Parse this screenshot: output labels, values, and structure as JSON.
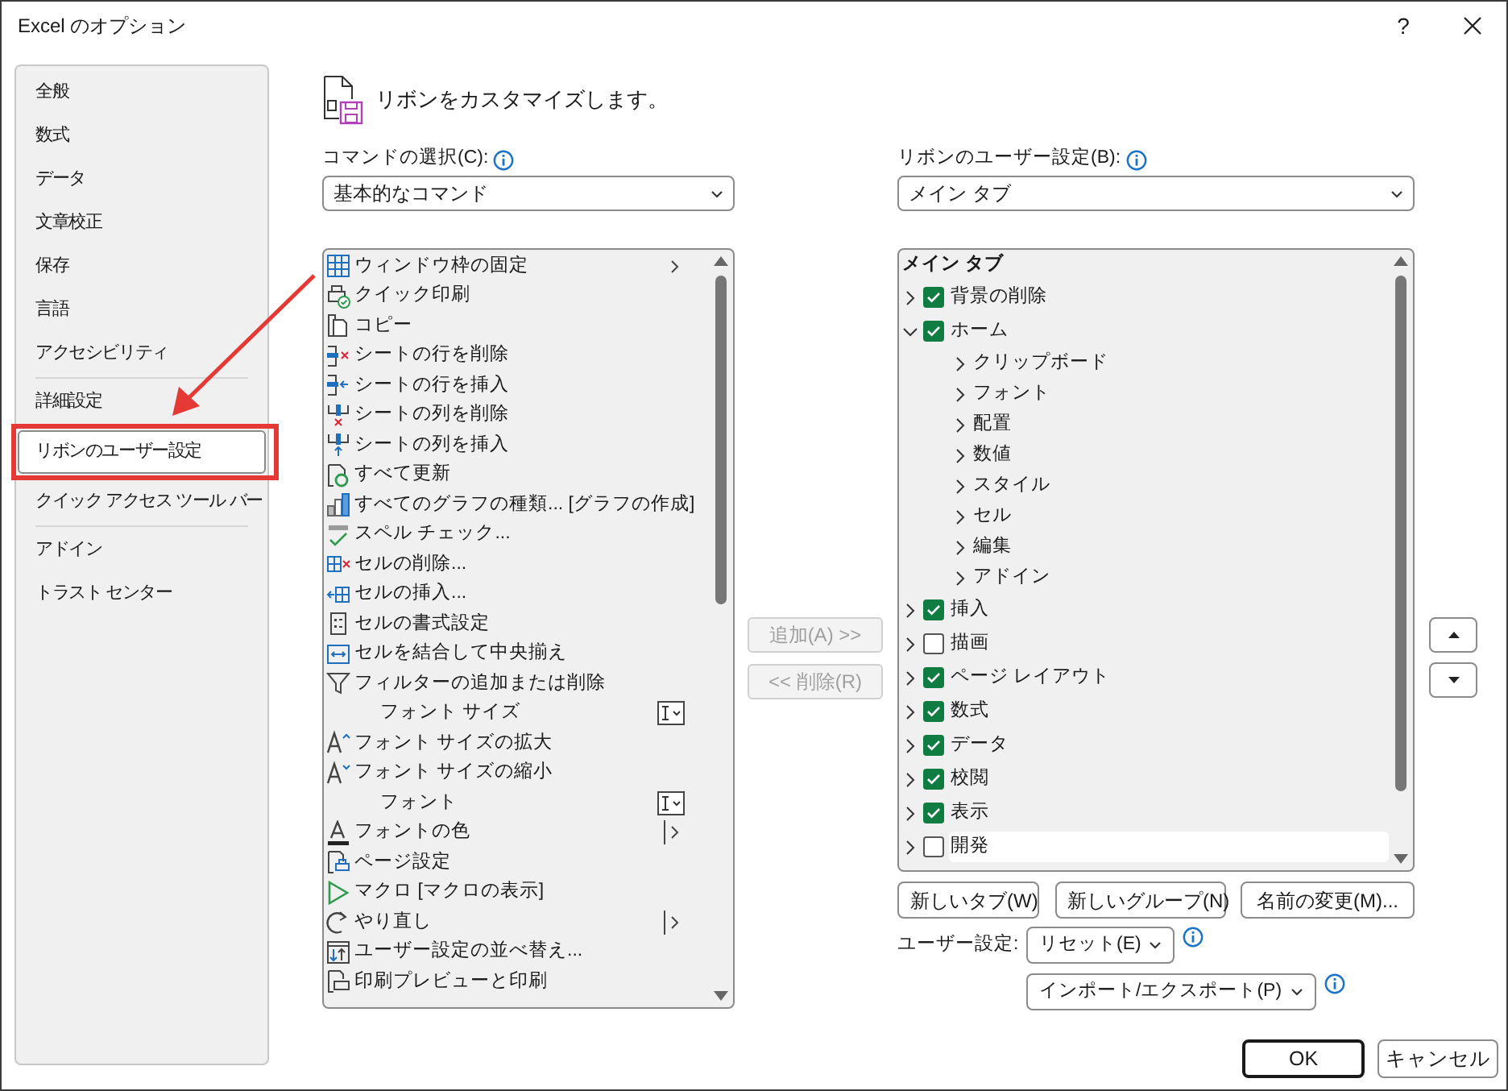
{
  "window": {
    "title": "Excel のオプション",
    "help": "?"
  },
  "sidebar": {
    "groups": [
      {
        "items": [
          {
            "label": "全般",
            "selected": false
          },
          {
            "label": "数式",
            "selected": false
          },
          {
            "label": "データ",
            "selected": false
          },
          {
            "label": "文章校正",
            "selected": false
          },
          {
            "label": "保存",
            "selected": false
          },
          {
            "label": "言語",
            "selected": false
          },
          {
            "label": "アクセシビリティ",
            "selected": false
          }
        ]
      },
      {
        "items": [
          {
            "label": "詳細設定",
            "selected": false
          },
          {
            "label": "リボンのユーザー設定",
            "selected": true
          },
          {
            "label": "クイック アクセス ツール バー",
            "selected": false
          }
        ]
      },
      {
        "items": [
          {
            "label": "アドイン",
            "selected": false
          },
          {
            "label": "トラスト センター",
            "selected": false
          }
        ]
      }
    ]
  },
  "header": {
    "text": "リボンをカスタマイズします。"
  },
  "commands": {
    "label": "コマンドの選択(C):",
    "dropdown": "基本的なコマンド",
    "items": [
      {
        "label": "ウィンドウ枠の固定"
      },
      {
        "label": "クイック印刷"
      },
      {
        "label": "コピー"
      },
      {
        "label": "シートの行を削除"
      },
      {
        "label": "シートの行を挿入"
      },
      {
        "label": "シートの列を削除"
      },
      {
        "label": "シートの列を挿入"
      },
      {
        "label": "すべて更新"
      },
      {
        "label": "すべてのグラフの種類... [グラフの作成]"
      },
      {
        "label": "スペル チェック..."
      },
      {
        "label": "セルの削除..."
      },
      {
        "label": "セルの挿入..."
      },
      {
        "label": "セルの書式設定"
      },
      {
        "label": "セルを結合して中央揃え"
      },
      {
        "label": "フィルターの追加または削除"
      },
      {
        "label": "フォント サイズ"
      },
      {
        "label": "フォント サイズの拡大"
      },
      {
        "label": "フォント サイズの縮小"
      },
      {
        "label": "フォント"
      },
      {
        "label": "フォントの色"
      },
      {
        "label": "ページ設定"
      },
      {
        "label": "マクロ [マクロの表示]"
      },
      {
        "label": "やり直し"
      },
      {
        "label": "ユーザー設定の並べ替え..."
      },
      {
        "label": "印刷プレビューと印刷"
      }
    ]
  },
  "transfer": {
    "add": {
      "label": "追加(A) >>",
      "disabled": true
    },
    "remove": {
      "label": "<< 削除(R)",
      "disabled": true
    }
  },
  "ribbon": {
    "label": "リボンのユーザー設定(B):",
    "dropdown": "メイン タブ",
    "heading": "メイン タブ",
    "tabs": [
      {
        "label": "背景の削除",
        "checked": true,
        "expanded": false,
        "selected": false
      },
      {
        "label": "ホーム",
        "checked": true,
        "expanded": true,
        "selected": false,
        "children": [
          {
            "label": "クリップボード",
            "expanded": false
          },
          {
            "label": "フォント",
            "expanded": false
          },
          {
            "label": "配置",
            "expanded": false
          },
          {
            "label": "数値",
            "expanded": false
          },
          {
            "label": "スタイル",
            "expanded": false
          },
          {
            "label": "セル",
            "expanded": false
          },
          {
            "label": "編集",
            "expanded": false
          },
          {
            "label": "アドイン",
            "expanded": false
          }
        ]
      },
      {
        "label": "挿入",
        "checked": true,
        "expanded": false,
        "selected": false
      },
      {
        "label": "描画",
        "checked": false,
        "expanded": false,
        "selected": false
      },
      {
        "label": "ページ レイアウト",
        "checked": true,
        "expanded": false,
        "selected": false
      },
      {
        "label": "数式",
        "checked": true,
        "expanded": false,
        "selected": false
      },
      {
        "label": "データ",
        "checked": true,
        "expanded": false,
        "selected": false
      },
      {
        "label": "校閲",
        "checked": true,
        "expanded": false,
        "selected": false
      },
      {
        "label": "表示",
        "checked": true,
        "expanded": false,
        "selected": false
      },
      {
        "label": "開発",
        "checked": false,
        "expanded": false,
        "selected": true
      }
    ],
    "buttons": [
      "新しいタブ(W)",
      "新しいグループ(N)",
      "名前の変更(M)..."
    ],
    "customize_label": "ユーザー設定:",
    "reset": "リセット(E)",
    "import_export": "インポート/エクスポート(P)"
  },
  "footer": {
    "ok": "OK",
    "cancel": "キャンセル"
  },
  "annotation": {
    "kind": "arrow-to-box"
  }
}
